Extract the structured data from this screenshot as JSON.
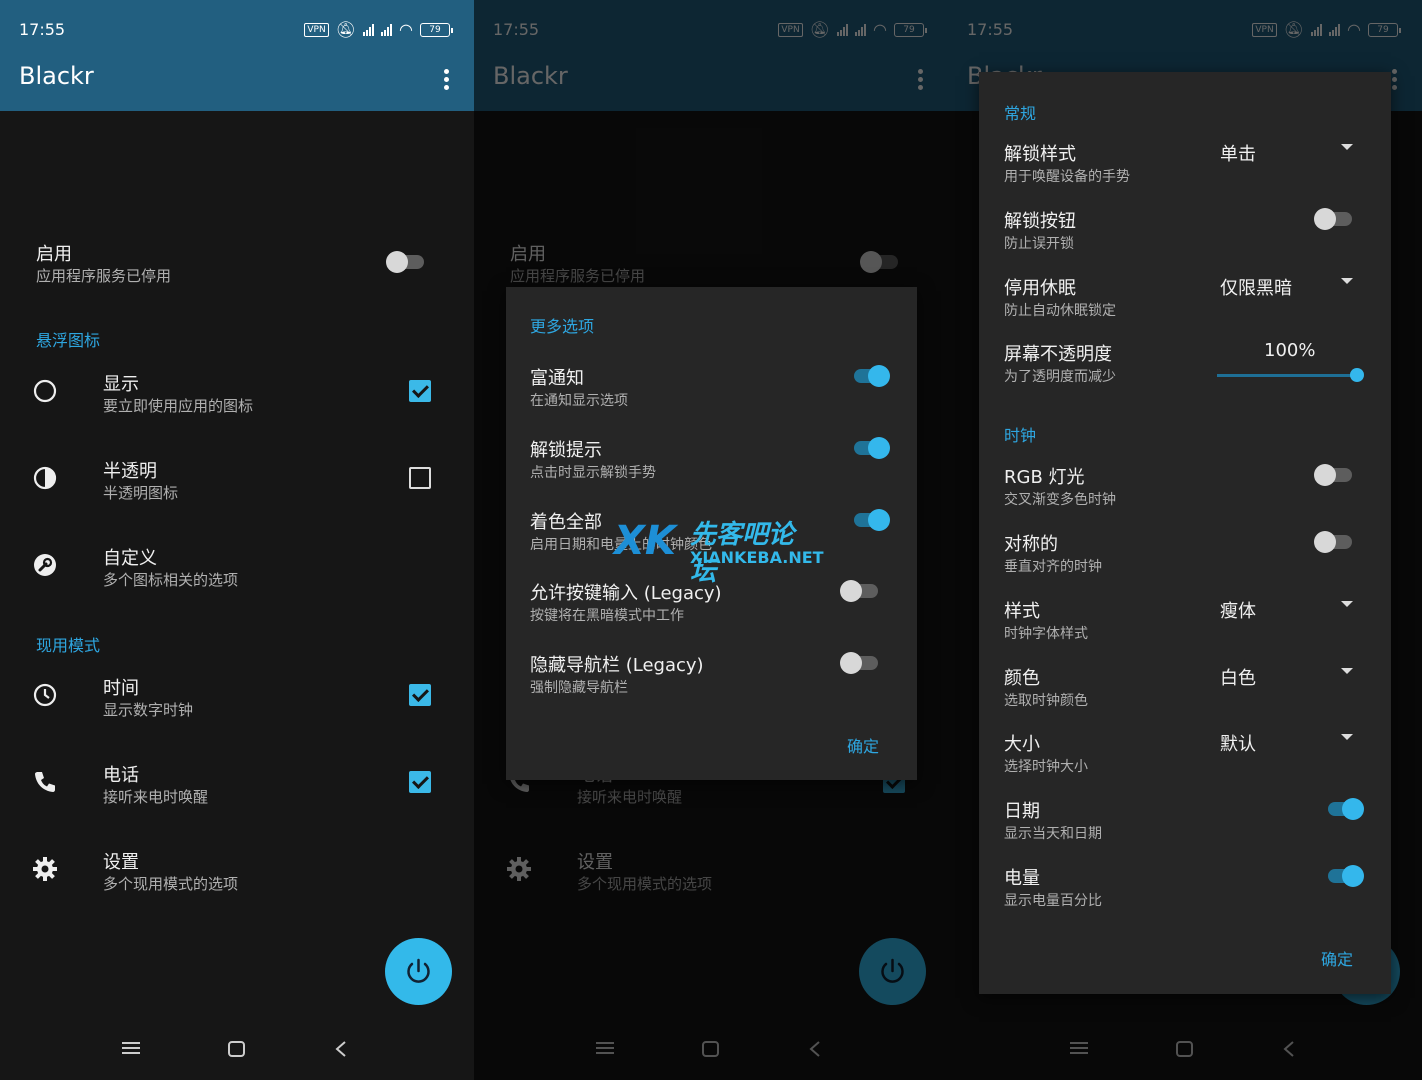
{
  "status_bar": {
    "time": "17:55",
    "vpn": "VPN",
    "battery": "79"
  },
  "app_title": "Blackr",
  "main": {
    "enable": {
      "title": "启用",
      "subtitle": "应用程序服务已停用"
    },
    "floating_icon_section": "悬浮图标",
    "floating_items": [
      {
        "title": "显示",
        "subtitle": "要立即使用应用的图标",
        "icon": "circle-icon",
        "checked": true
      },
      {
        "title": "半透明",
        "subtitle": "半透明图标",
        "icon": "half-circle-icon",
        "checked": false
      },
      {
        "title": "自定义",
        "subtitle": "多个图标相关的选项",
        "icon": "wrench-icon"
      }
    ],
    "mode_section": "现用模式",
    "mode_items": [
      {
        "title": "时间",
        "subtitle": "显示数字时钟",
        "icon": "clock-icon",
        "checked": true
      },
      {
        "title": "电话",
        "subtitle": "接听来电时唤醒",
        "icon": "phone-icon",
        "checked": true
      },
      {
        "title": "设置",
        "subtitle": "多个现用模式的选项",
        "icon": "gear-icon"
      }
    ]
  },
  "more_options_dialog": {
    "title": "更多选项",
    "items": [
      {
        "title": "富通知",
        "subtitle": "在通知显示选项",
        "on": true
      },
      {
        "title": "解锁提示",
        "subtitle": "点击时显示解锁手势",
        "on": true
      },
      {
        "title": "着色全部",
        "subtitle": "启用日期和电量上的时钟颜色",
        "on": true
      },
      {
        "title": "允许按键输入 (Legacy)",
        "subtitle": "按键将在黑暗模式中工作",
        "on": false
      },
      {
        "title": "隐藏导航栏 (Legacy)",
        "subtitle": "强制隐藏导航栏",
        "on": false
      }
    ],
    "ok": "确定"
  },
  "settings_dialog": {
    "general_section": "常规",
    "unlock_style": {
      "title": "解锁样式",
      "subtitle": "用于唤醒设备的手势",
      "value": "单击"
    },
    "unlock_button": {
      "title": "解锁按钮",
      "subtitle": "防止误开锁",
      "on": false
    },
    "disable_sleep": {
      "title": "停用休眠",
      "subtitle": "防止自动休眠锁定",
      "value": "仅限黑暗"
    },
    "opacity": {
      "title": "屏幕不透明度",
      "subtitle": "为了透明度而减少",
      "value_label": "100%",
      "value": 1.0
    },
    "clock_section": "时钟",
    "rgb": {
      "title": "RGB 灯光",
      "subtitle": "交叉渐变多色时钟",
      "on": false
    },
    "symmetric": {
      "title": "对称的",
      "subtitle": "垂直对齐的时钟",
      "on": false
    },
    "style": {
      "title": "样式",
      "subtitle": "时钟字体样式",
      "value": "瘦体"
    },
    "color": {
      "title": "颜色",
      "subtitle": "选取时钟颜色",
      "value": "白色"
    },
    "size": {
      "title": "大小",
      "subtitle": "选择时钟大小",
      "value": "默认"
    },
    "date": {
      "title": "日期",
      "subtitle": "显示当天和日期",
      "on": true
    },
    "battery": {
      "title": "电量",
      "subtitle": "显示电量百分比",
      "on": true
    },
    "ok": "确定"
  },
  "watermark": {
    "brand": "先客吧论坛",
    "domain": "XIANKEBA.NET",
    "logo": "XK"
  },
  "colors": {
    "accent": "#2ea6e0",
    "appbar": "#225f80",
    "fab": "#33b9ea"
  }
}
